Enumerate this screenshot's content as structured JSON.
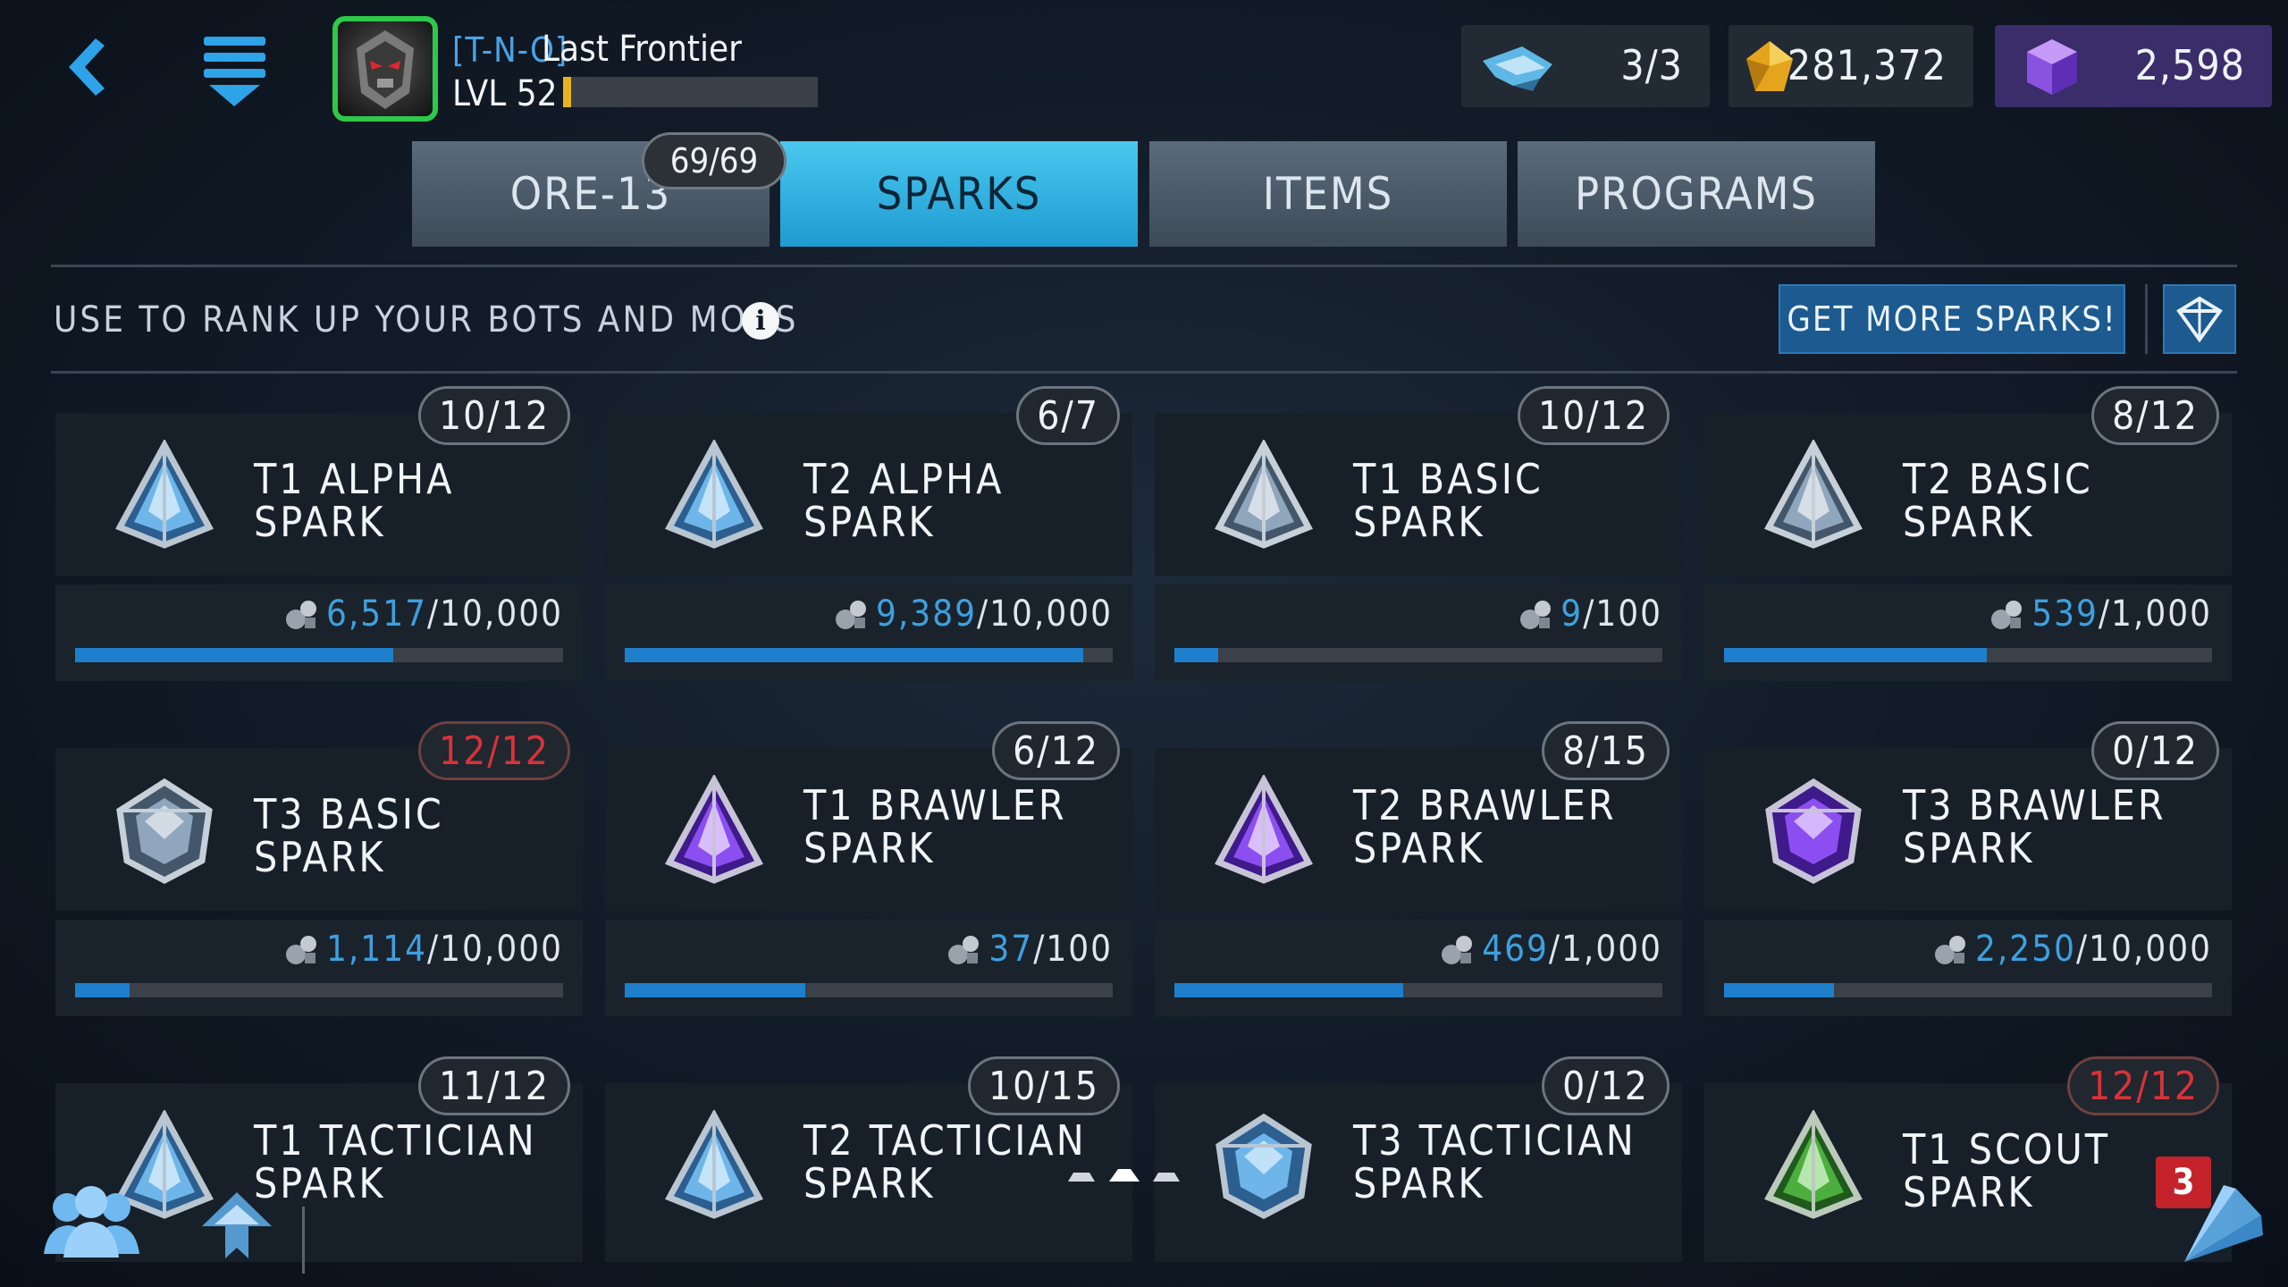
{
  "player": {
    "tag": "[T-N-O]",
    "name": "Last Frontier",
    "level": "LVL 52",
    "xp_fraction": 0.03
  },
  "resources": {
    "energy": "3/3",
    "gold": "281,372",
    "gems": "2,598"
  },
  "tabs": [
    {
      "label": "ORE-13",
      "active": false
    },
    {
      "label": "SPARKS",
      "active": true
    },
    {
      "label": "ITEMS",
      "active": false
    },
    {
      "label": "PROGRAMS",
      "active": false
    }
  ],
  "ore_badge": "69/69",
  "info_text": "USE TO RANK UP YOUR BOTS AND MODS",
  "get_more_label": "GET MORE SPARKS!",
  "cards": [
    {
      "count": "10/12",
      "max": false,
      "name": "T1 ALPHA SPARK",
      "current": "6,517",
      "total": "/10,000",
      "fraction": 0.6517,
      "color": "blue"
    },
    {
      "count": "6/7",
      "max": false,
      "name": "T2 ALPHA SPARK",
      "current": "9,389",
      "total": "/10,000",
      "fraction": 0.9389,
      "color": "blue"
    },
    {
      "count": "10/12",
      "max": false,
      "name": "T1 BASIC SPARK",
      "current": "9",
      "total": "/100",
      "fraction": 0.09,
      "color": "grey"
    },
    {
      "count": "8/12",
      "max": false,
      "name": "T2 BASIC SPARK",
      "current": "539",
      "total": "/1,000",
      "fraction": 0.539,
      "color": "grey"
    },
    {
      "count": "12/12",
      "max": true,
      "name": "T3 BASIC SPARK",
      "current": "1,114",
      "total": "/10,000",
      "fraction": 0.1114,
      "color": "grey"
    },
    {
      "count": "6/12",
      "max": false,
      "name": "T1 BRAWLER SPARK",
      "current": "37",
      "total": "/100",
      "fraction": 0.37,
      "color": "purple"
    },
    {
      "count": "8/15",
      "max": false,
      "name": "T2 BRAWLER SPARK",
      "current": "469",
      "total": "/1,000",
      "fraction": 0.469,
      "color": "purple"
    },
    {
      "count": "0/12",
      "max": false,
      "name": "T3 BRAWLER SPARK",
      "current": "2,250",
      "total": "/10,000",
      "fraction": 0.225,
      "color": "purple"
    },
    {
      "count": "11/12",
      "max": false,
      "name": "T1 TACTICIAN SPARK",
      "color": "blue"
    },
    {
      "count": "10/15",
      "max": false,
      "name": "T2 TACTICIAN SPARK",
      "color": "blue"
    },
    {
      "count": "0/12",
      "max": false,
      "name": "T3 TACTICIAN SPARK",
      "color": "blue"
    },
    {
      "count": "12/12",
      "max": true,
      "name": "T1 SCOUT SPARK",
      "color": "green"
    }
  ],
  "notification_count": "3",
  "colors": {
    "accent_blue": "#1e9bd0",
    "progress_blue": "#1e7fcc",
    "max_red": "#d8323a",
    "xp_yellow": "#e8b21d"
  }
}
